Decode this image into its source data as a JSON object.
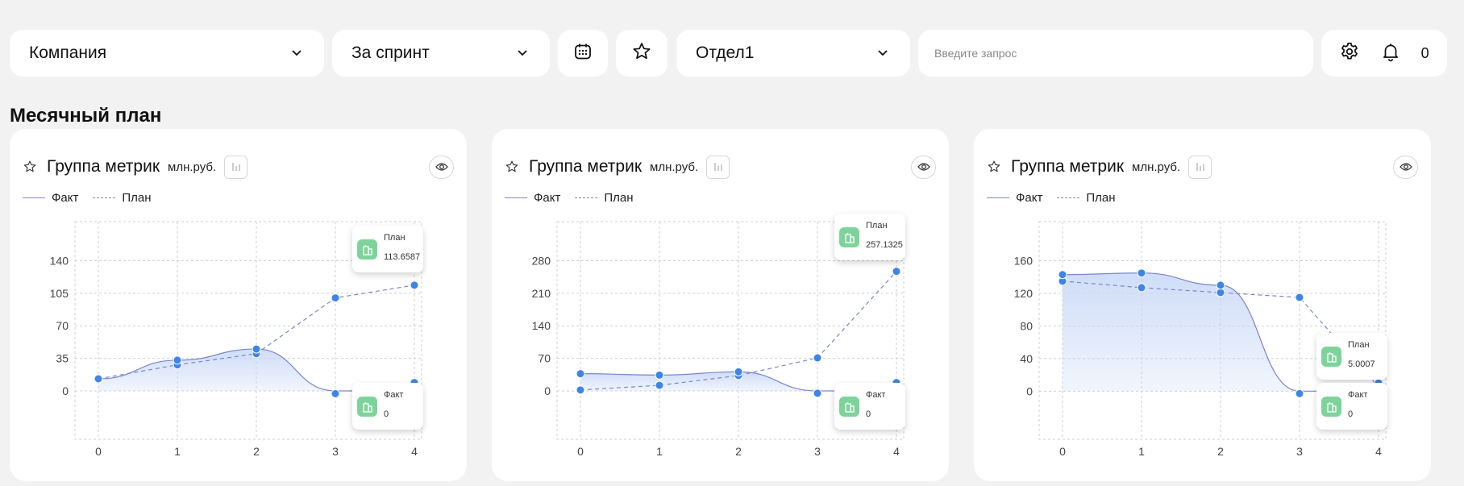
{
  "toolbar": {
    "company_select": "Компания",
    "period_select": "За спринт",
    "department_select": "Отдел1",
    "search_placeholder": "Введите запрос",
    "notification_count": "0"
  },
  "section_title": "Месячный план",
  "cards": [
    {
      "title": "Группа метрик",
      "unit": "млн.руб.",
      "legend_fact": "Факт",
      "legend_plan": "План",
      "tip_plan": {
        "label": "План",
        "value": "113.6587"
      },
      "tip_fact": {
        "label": "Факт",
        "value": "0"
      }
    },
    {
      "title": "Группа метрик",
      "unit": "млн.руб.",
      "legend_fact": "Факт",
      "legend_plan": "План",
      "tip_plan": {
        "label": "План",
        "value": "257.1325"
      },
      "tip_fact": {
        "label": "Факт",
        "value": "0"
      }
    },
    {
      "title": "Группа метрик",
      "unit": "млн.руб.",
      "legend_fact": "Факт",
      "legend_plan": "План",
      "tip_plan": {
        "label": "План",
        "value": "5.0007"
      },
      "tip_fact": {
        "label": "Факт",
        "value": "0"
      }
    }
  ],
  "chart_data": [
    {
      "type": "area",
      "x": [
        0,
        1,
        2,
        3,
        4
      ],
      "yticks": [
        0,
        35,
        70,
        105,
        140
      ],
      "ylim": [
        -52,
        182
      ],
      "series": [
        {
          "name": "Факт",
          "values": [
            13,
            33,
            45,
            0,
            null
          ],
          "style": "solid"
        },
        {
          "name": "План",
          "values": [
            13,
            28,
            40,
            100,
            113.6587
          ],
          "style": "dashed"
        }
      ],
      "extra_points": [
        {
          "x": 3,
          "y": -3
        },
        {
          "x": 4,
          "y": 9
        }
      ],
      "grid": true
    },
    {
      "type": "area",
      "x": [
        0,
        1,
        2,
        3,
        4
      ],
      "yticks": [
        0,
        70,
        140,
        210,
        280
      ],
      "ylim": [
        -104,
        364
      ],
      "series": [
        {
          "name": "Факт",
          "values": [
            37,
            34,
            41,
            0,
            null
          ],
          "style": "solid"
        },
        {
          "name": "План",
          "values": [
            2,
            12,
            33,
            71,
            257.1325
          ],
          "style": "dashed"
        }
      ],
      "extra_points": [
        {
          "x": 3,
          "y": -5
        },
        {
          "x": 4,
          "y": 18
        }
      ],
      "grid": true
    },
    {
      "type": "area",
      "x": [
        0,
        1,
        2,
        3,
        4
      ],
      "yticks": [
        0,
        40,
        80,
        120,
        160
      ],
      "ylim": [
        -59,
        208
      ],
      "series": [
        {
          "name": "Факт",
          "values": [
            143,
            145,
            130,
            0,
            null
          ],
          "style": "solid"
        },
        {
          "name": "План",
          "values": [
            135,
            127,
            121,
            115,
            5.0007
          ],
          "style": "dashed"
        }
      ],
      "extra_points": [
        {
          "x": 3,
          "y": -3
        },
        {
          "x": 4,
          "y": 10
        }
      ],
      "grid": true
    }
  ],
  "colors": {
    "background": "#f2f2f2",
    "card": "#ffffff",
    "line": "#7986cb",
    "point": "#3d85e8",
    "area_top": "#c7d7f7",
    "icon_green": "#7ed39a"
  }
}
